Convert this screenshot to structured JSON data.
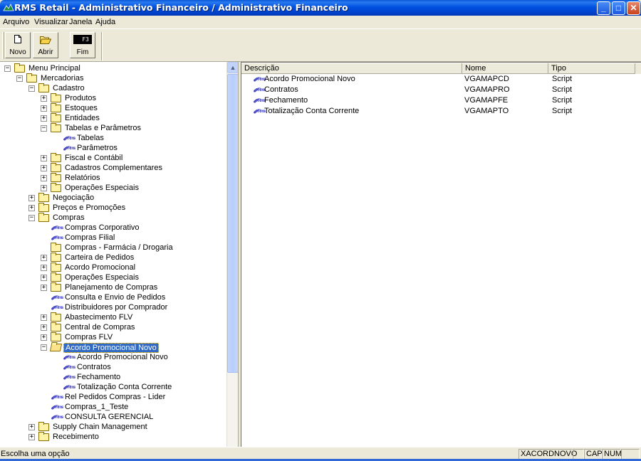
{
  "window": {
    "title": "RMS Retail - Administrativo Financeiro / Administrativo Financeiro",
    "buttons": {
      "minimize": "_",
      "maximize": "□",
      "close": "✕"
    }
  },
  "menubar": {
    "items": [
      {
        "label": "Arquivo"
      },
      {
        "label": "Visualizar"
      },
      {
        "label": "Janela"
      },
      {
        "label": "Ajuda"
      }
    ]
  },
  "toolbar": {
    "novo_label": "Novo",
    "abrir_label": "Abrir",
    "fim_label": "Fim",
    "fim_key": "F3"
  },
  "tree": {
    "items": [
      {
        "label": "Menu Principal",
        "level": 0,
        "kind": "folder",
        "expander": "−"
      },
      {
        "label": "Mercadorias",
        "level": 1,
        "kind": "folder",
        "expander": "−"
      },
      {
        "label": "Cadastro",
        "level": 2,
        "kind": "folder",
        "expander": "−"
      },
      {
        "label": "Produtos",
        "level": 3,
        "kind": "folder",
        "expander": "+"
      },
      {
        "label": "Estoques",
        "level": 3,
        "kind": "folder",
        "expander": "+"
      },
      {
        "label": "Entidades",
        "level": 3,
        "kind": "folder",
        "expander": "+"
      },
      {
        "label": "Tabelas e Parâmetros",
        "level": 3,
        "kind": "folder",
        "expander": "−"
      },
      {
        "label": "Tabelas",
        "level": 4,
        "kind": "script",
        "expander": ""
      },
      {
        "label": "Parâmetros",
        "level": 4,
        "kind": "script",
        "expander": ""
      },
      {
        "label": "Fiscal e Contábil",
        "level": 3,
        "kind": "folder",
        "expander": "+"
      },
      {
        "label": "Cadastros Complementares",
        "level": 3,
        "kind": "folder",
        "expander": "+"
      },
      {
        "label": "Relatórios",
        "level": 3,
        "kind": "folder",
        "expander": "+"
      },
      {
        "label": "Operações Especiais",
        "level": 3,
        "kind": "folder",
        "expander": "+"
      },
      {
        "label": "Negociação",
        "level": 2,
        "kind": "folder",
        "expander": "+"
      },
      {
        "label": "Preços e Promoções",
        "level": 2,
        "kind": "folder",
        "expander": "+"
      },
      {
        "label": "Compras",
        "level": 2,
        "kind": "folder",
        "expander": "−"
      },
      {
        "label": "Compras Corporativo",
        "level": 3,
        "kind": "script",
        "expander": ""
      },
      {
        "label": "Compras Filial",
        "level": 3,
        "kind": "script",
        "expander": ""
      },
      {
        "label": "Compras - Farmácia / Drogaria",
        "level": 3,
        "kind": "folder",
        "expander": ""
      },
      {
        "label": "Carteira de Pedidos",
        "level": 3,
        "kind": "folder",
        "expander": "+"
      },
      {
        "label": "Acordo Promocional",
        "level": 3,
        "kind": "folder",
        "expander": "+"
      },
      {
        "label": "Operações Especiais",
        "level": 3,
        "kind": "folder",
        "expander": "+"
      },
      {
        "label": "Planejamento de Compras",
        "level": 3,
        "kind": "folder",
        "expander": "+"
      },
      {
        "label": "Consulta e Envio de Pedidos",
        "level": 3,
        "kind": "script",
        "expander": ""
      },
      {
        "label": "Distribuidores por Comprador",
        "level": 3,
        "kind": "script",
        "expander": ""
      },
      {
        "label": "Abastecimento FLV",
        "level": 3,
        "kind": "folder",
        "expander": "+"
      },
      {
        "label": "Central de Compras",
        "level": 3,
        "kind": "folder",
        "expander": "+"
      },
      {
        "label": "Compras FLV",
        "level": 3,
        "kind": "folder",
        "expander": "+"
      },
      {
        "label": "Acordo Promocional Novo",
        "level": 3,
        "kind": "folder-open",
        "expander": "−",
        "selected": true
      },
      {
        "label": "Acordo Promocional Novo",
        "level": 4,
        "kind": "script",
        "expander": ""
      },
      {
        "label": "Contratos",
        "level": 4,
        "kind": "script",
        "expander": ""
      },
      {
        "label": "Fechamento",
        "level": 4,
        "kind": "script",
        "expander": ""
      },
      {
        "label": "Totalização Conta Corrente",
        "level": 4,
        "kind": "script",
        "expander": ""
      },
      {
        "label": "Rel Pedidos Compras - Lider",
        "level": 3,
        "kind": "script",
        "expander": ""
      },
      {
        "label": "Compras_1_Teste",
        "level": 3,
        "kind": "script",
        "expander": ""
      },
      {
        "label": "CONSULTA GERENCIAL",
        "level": 3,
        "kind": "script",
        "expander": ""
      },
      {
        "label": "Supply Chain Management",
        "level": 2,
        "kind": "folder",
        "expander": "+"
      },
      {
        "label": "Recebimento",
        "level": 2,
        "kind": "folder",
        "expander": "+"
      }
    ]
  },
  "list": {
    "columns": [
      "Descrição",
      "Nome",
      "Tipo"
    ],
    "rows": [
      {
        "descricao": "Acordo Promocional Novo",
        "nome": "VGAMAPCD",
        "tipo": "Script"
      },
      {
        "descricao": "Contratos",
        "nome": "VGAMAPRO",
        "tipo": "Script"
      },
      {
        "descricao": "Fechamento",
        "nome": "VGAMAPFE",
        "tipo": "Script"
      },
      {
        "descricao": "Totalização Conta Corrente",
        "nome": "VGAMAPTO",
        "tipo": "Script"
      }
    ]
  },
  "statusbar": {
    "message": "Escolha uma opção",
    "program": "XACORDNOVO",
    "cap": "CAP",
    "num": "NUM"
  },
  "icons": {
    "script_glyph": "✐ᴿᵐˢ",
    "colors": {
      "title_blue": "#0050e0",
      "selection": "#316ac5",
      "folder": "#fff3a8"
    }
  }
}
